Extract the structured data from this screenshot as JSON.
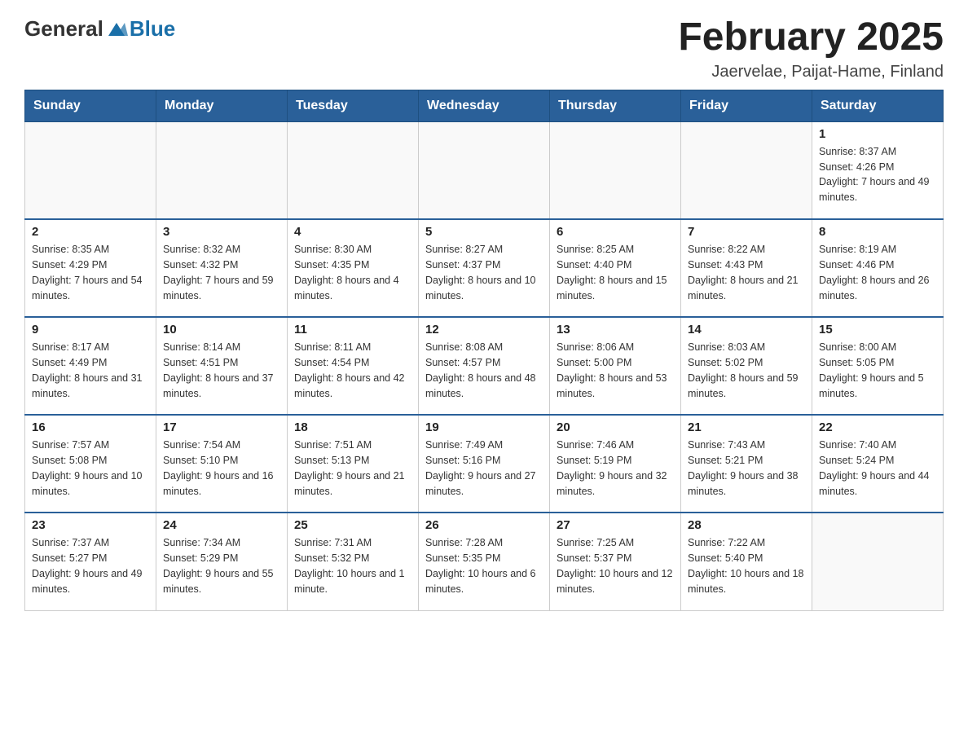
{
  "header": {
    "logo": {
      "general": "General",
      "blue": "Blue"
    },
    "title": "February 2025",
    "location": "Jaervelae, Paijat-Hame, Finland"
  },
  "calendar": {
    "weekdays": [
      "Sunday",
      "Monday",
      "Tuesday",
      "Wednesday",
      "Thursday",
      "Friday",
      "Saturday"
    ],
    "weeks": [
      [
        {
          "day": "",
          "info": ""
        },
        {
          "day": "",
          "info": ""
        },
        {
          "day": "",
          "info": ""
        },
        {
          "day": "",
          "info": ""
        },
        {
          "day": "",
          "info": ""
        },
        {
          "day": "",
          "info": ""
        },
        {
          "day": "1",
          "info": "Sunrise: 8:37 AM\nSunset: 4:26 PM\nDaylight: 7 hours and 49 minutes."
        }
      ],
      [
        {
          "day": "2",
          "info": "Sunrise: 8:35 AM\nSunset: 4:29 PM\nDaylight: 7 hours and 54 minutes."
        },
        {
          "day": "3",
          "info": "Sunrise: 8:32 AM\nSunset: 4:32 PM\nDaylight: 7 hours and 59 minutes."
        },
        {
          "day": "4",
          "info": "Sunrise: 8:30 AM\nSunset: 4:35 PM\nDaylight: 8 hours and 4 minutes."
        },
        {
          "day": "5",
          "info": "Sunrise: 8:27 AM\nSunset: 4:37 PM\nDaylight: 8 hours and 10 minutes."
        },
        {
          "day": "6",
          "info": "Sunrise: 8:25 AM\nSunset: 4:40 PM\nDaylight: 8 hours and 15 minutes."
        },
        {
          "day": "7",
          "info": "Sunrise: 8:22 AM\nSunset: 4:43 PM\nDaylight: 8 hours and 21 minutes."
        },
        {
          "day": "8",
          "info": "Sunrise: 8:19 AM\nSunset: 4:46 PM\nDaylight: 8 hours and 26 minutes."
        }
      ],
      [
        {
          "day": "9",
          "info": "Sunrise: 8:17 AM\nSunset: 4:49 PM\nDaylight: 8 hours and 31 minutes."
        },
        {
          "day": "10",
          "info": "Sunrise: 8:14 AM\nSunset: 4:51 PM\nDaylight: 8 hours and 37 minutes."
        },
        {
          "day": "11",
          "info": "Sunrise: 8:11 AM\nSunset: 4:54 PM\nDaylight: 8 hours and 42 minutes."
        },
        {
          "day": "12",
          "info": "Sunrise: 8:08 AM\nSunset: 4:57 PM\nDaylight: 8 hours and 48 minutes."
        },
        {
          "day": "13",
          "info": "Sunrise: 8:06 AM\nSunset: 5:00 PM\nDaylight: 8 hours and 53 minutes."
        },
        {
          "day": "14",
          "info": "Sunrise: 8:03 AM\nSunset: 5:02 PM\nDaylight: 8 hours and 59 minutes."
        },
        {
          "day": "15",
          "info": "Sunrise: 8:00 AM\nSunset: 5:05 PM\nDaylight: 9 hours and 5 minutes."
        }
      ],
      [
        {
          "day": "16",
          "info": "Sunrise: 7:57 AM\nSunset: 5:08 PM\nDaylight: 9 hours and 10 minutes."
        },
        {
          "day": "17",
          "info": "Sunrise: 7:54 AM\nSunset: 5:10 PM\nDaylight: 9 hours and 16 minutes."
        },
        {
          "day": "18",
          "info": "Sunrise: 7:51 AM\nSunset: 5:13 PM\nDaylight: 9 hours and 21 minutes."
        },
        {
          "day": "19",
          "info": "Sunrise: 7:49 AM\nSunset: 5:16 PM\nDaylight: 9 hours and 27 minutes."
        },
        {
          "day": "20",
          "info": "Sunrise: 7:46 AM\nSunset: 5:19 PM\nDaylight: 9 hours and 32 minutes."
        },
        {
          "day": "21",
          "info": "Sunrise: 7:43 AM\nSunset: 5:21 PM\nDaylight: 9 hours and 38 minutes."
        },
        {
          "day": "22",
          "info": "Sunrise: 7:40 AM\nSunset: 5:24 PM\nDaylight: 9 hours and 44 minutes."
        }
      ],
      [
        {
          "day": "23",
          "info": "Sunrise: 7:37 AM\nSunset: 5:27 PM\nDaylight: 9 hours and 49 minutes."
        },
        {
          "day": "24",
          "info": "Sunrise: 7:34 AM\nSunset: 5:29 PM\nDaylight: 9 hours and 55 minutes."
        },
        {
          "day": "25",
          "info": "Sunrise: 7:31 AM\nSunset: 5:32 PM\nDaylight: 10 hours and 1 minute."
        },
        {
          "day": "26",
          "info": "Sunrise: 7:28 AM\nSunset: 5:35 PM\nDaylight: 10 hours and 6 minutes."
        },
        {
          "day": "27",
          "info": "Sunrise: 7:25 AM\nSunset: 5:37 PM\nDaylight: 10 hours and 12 minutes."
        },
        {
          "day": "28",
          "info": "Sunrise: 7:22 AM\nSunset: 5:40 PM\nDaylight: 10 hours and 18 minutes."
        },
        {
          "day": "",
          "info": ""
        }
      ]
    ]
  }
}
